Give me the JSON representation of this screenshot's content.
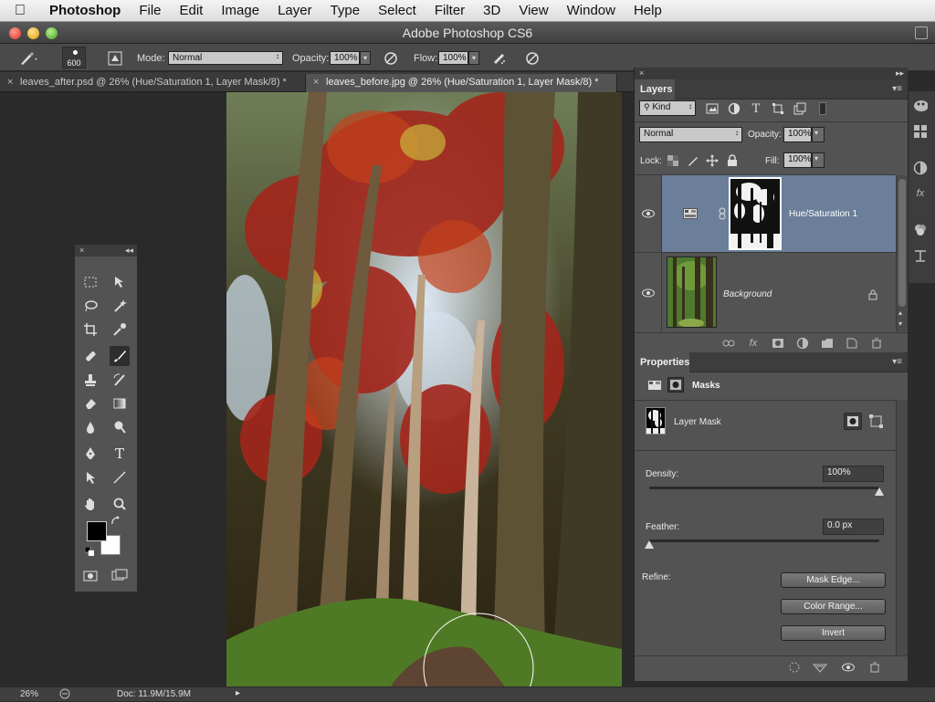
{
  "menubar": {
    "app": "Photoshop",
    "items": [
      "File",
      "Edit",
      "Image",
      "Layer",
      "Type",
      "Select",
      "Filter",
      "3D",
      "View",
      "Window",
      "Help"
    ]
  },
  "window": {
    "title": "Adobe Photoshop CS6"
  },
  "options": {
    "brush_size": "600",
    "mode_label": "Mode:",
    "mode_value": "Normal",
    "opacity_label": "Opacity:",
    "opacity_value": "100%",
    "flow_label": "Flow:",
    "flow_value": "100%"
  },
  "tabs": [
    {
      "label": "leaves_after.psd @ 26% (Hue/Saturation 1, Layer Mask/8) *",
      "active": false
    },
    {
      "label": "leaves_before.jpg @ 26% (Hue/Saturation 1, Layer Mask/8) *",
      "active": true
    }
  ],
  "status": {
    "zoom": "26%",
    "doc": "Doc: 11.9M/15.9M"
  },
  "layers_panel": {
    "title": "Layers",
    "filter_value": "Kind",
    "blend_mode": "Normal",
    "opacity_label": "Opacity:",
    "opacity_value": "100%",
    "lock_label": "Lock:",
    "fill_label": "Fill:",
    "fill_value": "100%",
    "layers": [
      {
        "name": "Hue/Saturation 1",
        "selected": true
      },
      {
        "name": "Background",
        "selected": false
      }
    ]
  },
  "properties_panel": {
    "title": "Properties",
    "section": "Masks",
    "mask_type": "Layer Mask",
    "density_label": "Density:",
    "density_value": "100%",
    "density_level": 1.0,
    "feather_label": "Feather:",
    "feather_value": "0.0 px",
    "feather_level": 0.0,
    "refine_label": "Refine:",
    "buttons": [
      "Mask Edge...",
      "Color Range...",
      "Invert"
    ]
  },
  "colors": {
    "foreground": "#000000",
    "background": "#ffffff",
    "selected_layer": "#6b7f9a"
  }
}
